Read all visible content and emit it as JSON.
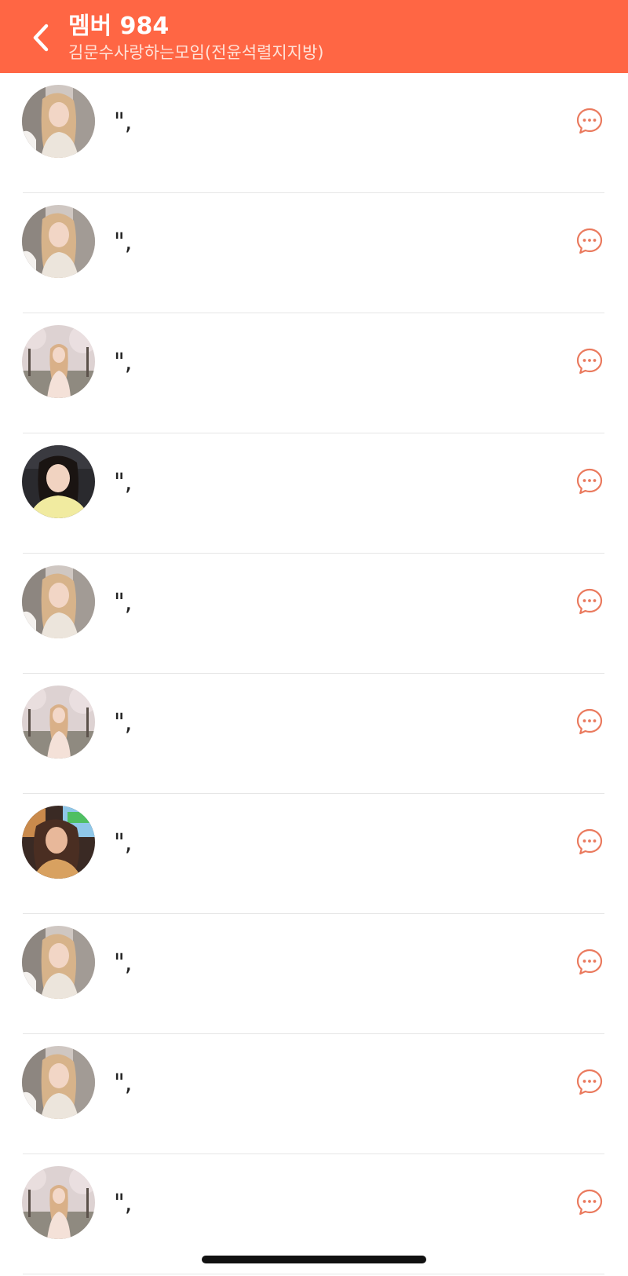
{
  "header": {
    "back_icon": "chevron-left-icon",
    "title": "멤버 984",
    "subtitle": "김문수사랑하는모임(전윤석렬지지방)",
    "background_color": "#ff6644"
  },
  "members": [
    {
      "name": "\",",
      "avatar": "blonde-portrait",
      "chat_icon": "chat-bubble-ellipsis-icon"
    },
    {
      "name": "\",",
      "avatar": "blonde-portrait",
      "chat_icon": "chat-bubble-ellipsis-icon"
    },
    {
      "name": "\",",
      "avatar": "cherry-blossom-portrait",
      "chat_icon": "chat-bubble-ellipsis-icon"
    },
    {
      "name": "\",",
      "avatar": "car-selfie-portrait",
      "chat_icon": "chat-bubble-ellipsis-icon"
    },
    {
      "name": "\",",
      "avatar": "blonde-portrait",
      "chat_icon": "chat-bubble-ellipsis-icon"
    },
    {
      "name": "\",",
      "avatar": "cherry-blossom-portrait",
      "chat_icon": "chat-bubble-ellipsis-icon"
    },
    {
      "name": "\",",
      "avatar": "night-selfie-portrait",
      "chat_icon": "chat-bubble-ellipsis-icon"
    },
    {
      "name": "\",",
      "avatar": "blonde-portrait",
      "chat_icon": "chat-bubble-ellipsis-icon"
    },
    {
      "name": "\",",
      "avatar": "blonde-portrait",
      "chat_icon": "chat-bubble-ellipsis-icon"
    },
    {
      "name": "\",",
      "avatar": "cherry-blossom-portrait",
      "chat_icon": "chat-bubble-ellipsis-icon"
    }
  ],
  "colors": {
    "accent": "#ff6644",
    "chat_icon": "#ea7a5e",
    "divider": "#e6e6e6"
  }
}
